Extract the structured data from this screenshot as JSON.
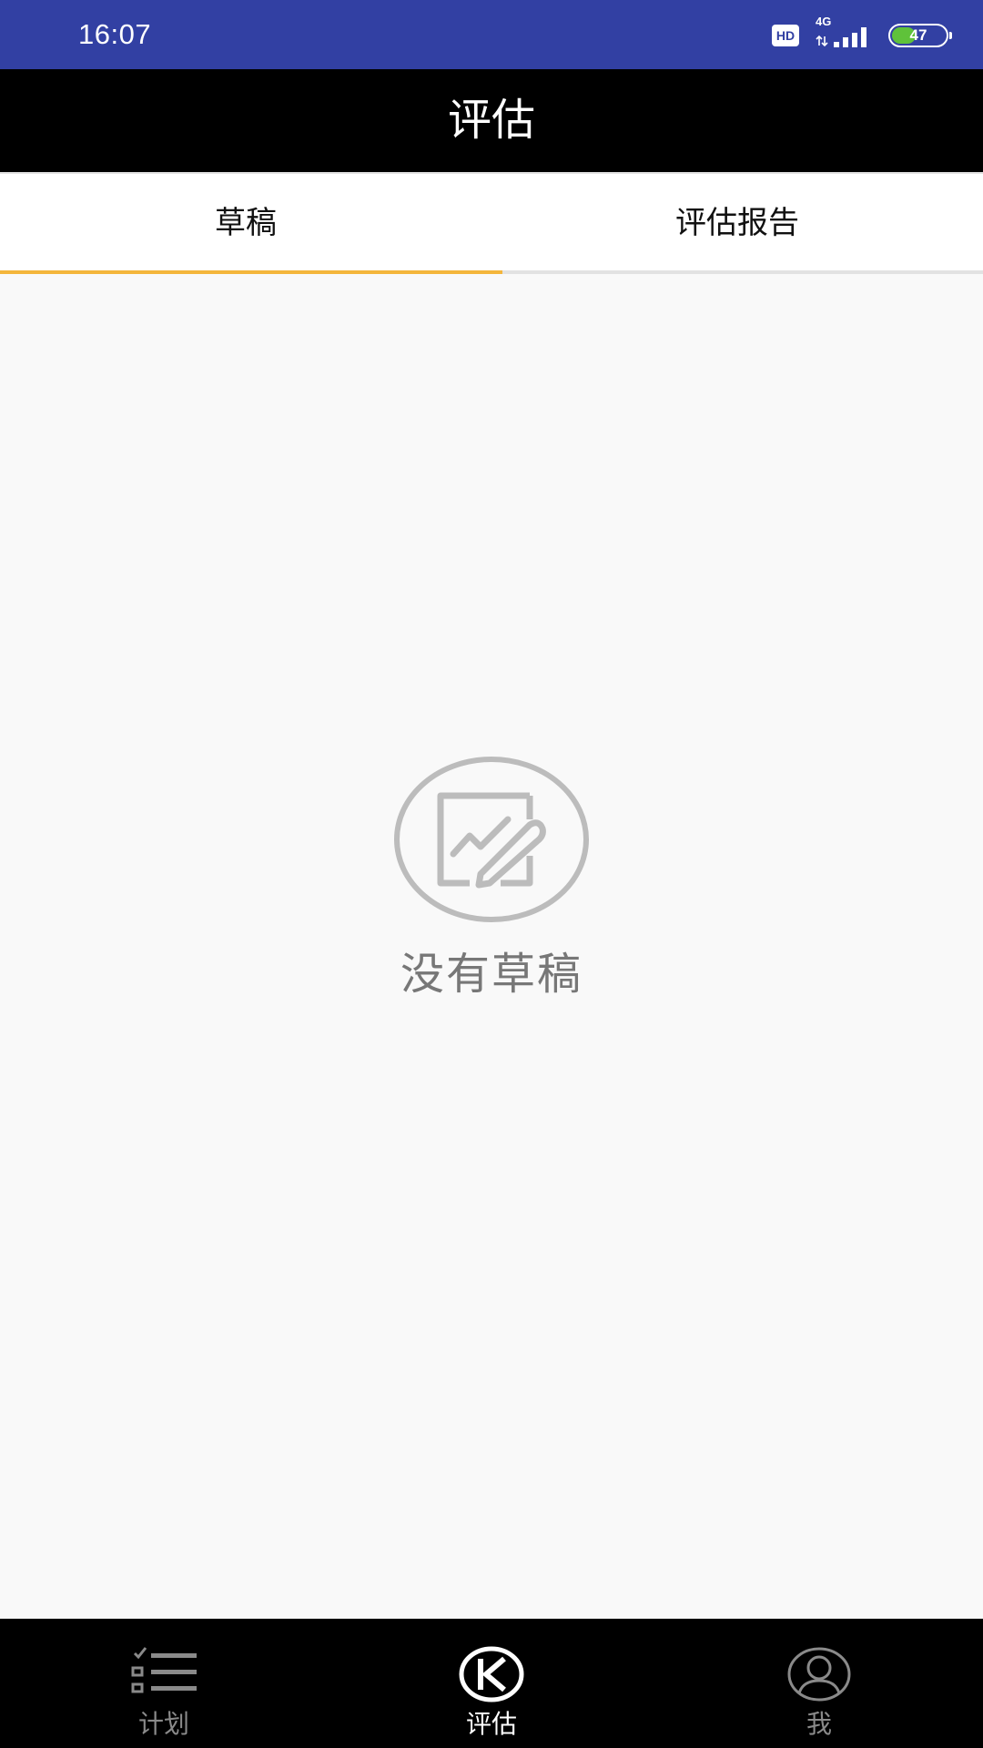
{
  "status_bar": {
    "time": "16:07",
    "hd_label": "HD",
    "network_label": "4G",
    "battery_percent": "47",
    "colors": {
      "background": "#3240a3",
      "battery_fill": "#5fc23a"
    }
  },
  "header": {
    "title": "评估"
  },
  "tabs": {
    "selected_index": 0,
    "items": [
      {
        "label": "草稿",
        "selected": true
      },
      {
        "label": "评估报告",
        "selected": false
      }
    ],
    "colors": {
      "indicator": "#f4b63c"
    }
  },
  "empty_state": {
    "icon": "edit-document-icon",
    "message": "没有草稿"
  },
  "bottom_nav": {
    "items": [
      {
        "label": "计划",
        "icon": "checklist-icon",
        "active": false
      },
      {
        "label": "评估",
        "icon": "k-logo-icon",
        "active": true
      },
      {
        "label": "我",
        "icon": "person-icon",
        "active": false
      }
    ],
    "colors": {
      "active": "#ffffff",
      "inactive": "#8a8a8a",
      "background": "#000000"
    }
  }
}
